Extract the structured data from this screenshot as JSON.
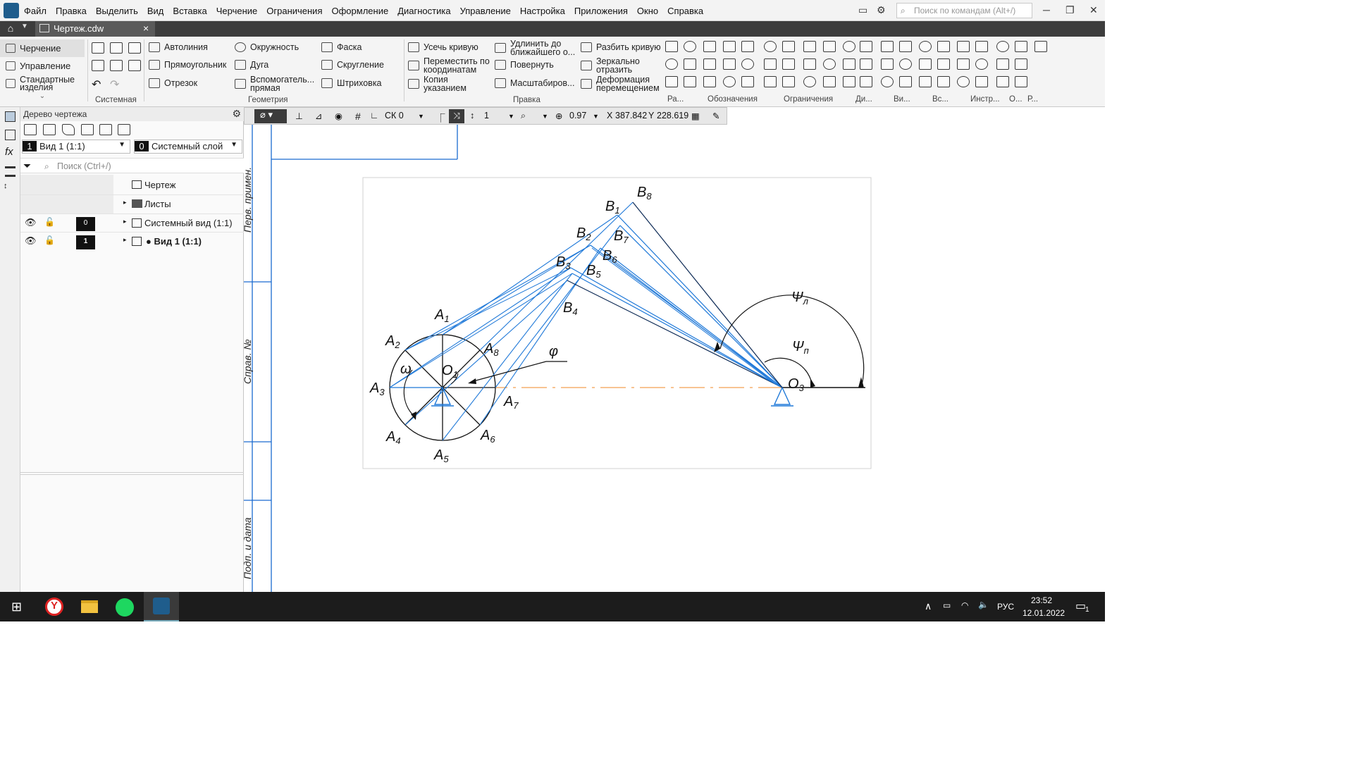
{
  "menubar": {
    "items": [
      "Файл",
      "Правка",
      "Выделить",
      "Вид",
      "Вставка",
      "Черчение",
      "Ограничения",
      "Оформление",
      "Диагностика",
      "Управление",
      "Настройка",
      "Приложения",
      "Окно",
      "Справка"
    ],
    "search_placeholder": "Поиск по командам (Alt+/)"
  },
  "tabbar": {
    "document_tab": "Чертеж.cdw"
  },
  "ribbon": {
    "modes": [
      "Черчение",
      "Управление",
      "Стандартные изделия"
    ],
    "system": {
      "group": "Системная"
    },
    "geometry": {
      "items": [
        "Автолиния",
        "Окружность",
        "Фаска",
        "Прямоугольник",
        "Дуга",
        "Скругление",
        "Отрезок",
        "Вспомогатель... прямая",
        "Штриховка"
      ],
      "group": "Геометрия"
    },
    "edit": {
      "items": [
        "Усечь кривую",
        "Удлинить до ближайшего о...",
        "Разбить кривую",
        "Переместить по координатам",
        "Повернуть",
        "Зеркально отразить",
        "Копия указанием",
        "Масштабиров...",
        "Деформация перемещением"
      ],
      "group": "Правка"
    },
    "small_groups": [
      "Ра...",
      "Обозначения",
      "Ограничения",
      "Ди...",
      "Ви...",
      "Вс...",
      "Инстр...",
      "О...",
      "Р..."
    ]
  },
  "tree": {
    "title": "Дерево чертежа",
    "view_combo": {
      "num": "1",
      "label": "Вид 1 (1:1)"
    },
    "layer_combo": {
      "num": "0",
      "label": "Системный слой"
    },
    "search_placeholder": "Поиск (Ctrl+/)",
    "items": [
      {
        "label": "Чертеж"
      },
      {
        "label": "Листы"
      },
      {
        "label": "Системный вид (1:1)",
        "index": "0"
      },
      {
        "label": "● Вид 1 (1:1)",
        "index": "1"
      }
    ]
  },
  "draw_toolbar": {
    "cs": "СК 0",
    "step": "1",
    "zoom": "0.97",
    "x_label": "X",
    "x_value": "387.842",
    "y_label": "Y",
    "y_value": "228.619"
  },
  "frame_labels": {
    "perv": "Перв. примен.",
    "sprav": "Справ. №",
    "podp": "Подп. и дата"
  },
  "drawing": {
    "labels": {
      "B8": [
        "B",
        "8"
      ],
      "B1": [
        "B",
        "1"
      ],
      "B2": [
        "B",
        "2"
      ],
      "B7": [
        "B",
        "7"
      ],
      "B3": [
        "B",
        "3"
      ],
      "B6": [
        "B",
        "6"
      ],
      "B5": [
        "B",
        "5"
      ],
      "B4": [
        "B",
        "4"
      ],
      "A1": [
        "A",
        "1"
      ],
      "A2": [
        "A",
        "2"
      ],
      "A8": [
        "A",
        "8"
      ],
      "A3": [
        "A",
        "3"
      ],
      "A4": [
        "A",
        "4"
      ],
      "A5": [
        "A",
        "5"
      ],
      "A6": [
        "A",
        "6"
      ],
      "A7": [
        "A",
        "7"
      ],
      "O1": [
        "O",
        "1"
      ],
      "O3": [
        "O",
        "3"
      ],
      "omega": [
        "ω",
        ""
      ],
      "phi": [
        "φ",
        ""
      ],
      "psiL": [
        "Ψ",
        "л"
      ],
      "psiP": [
        "Ψ",
        "п"
      ]
    },
    "colors": {
      "links": "#1e78d8",
      "dark": "#0d2a55",
      "axis": "#f08a24",
      "frame": "#1a6bd0"
    }
  },
  "taskbar": {
    "lang": "РУС",
    "time": "23:52",
    "date": "12.01.2022",
    "notif": "1"
  }
}
